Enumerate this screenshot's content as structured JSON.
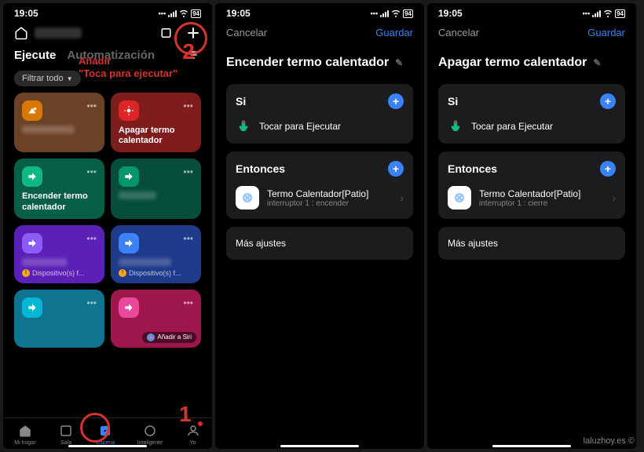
{
  "status": {
    "time": "19:05",
    "battery": "94"
  },
  "screen1": {
    "tabs": {
      "execute": "Ejecute",
      "automation": "Automatización"
    },
    "filter": "Filtrar todo",
    "cards": {
      "c2_title": "Apagar termo calentador",
      "c3_title": "Encender termo calentador",
      "warning": "Dispositivo(s) f...",
      "siri": "Añadir a Siri"
    },
    "nav": {
      "home": "Mi hogar",
      "room": "Sala",
      "scene": "Escena",
      "smart": "Inteligente",
      "me": "Yo"
    },
    "annotations": {
      "add": "Añadir",
      "tap": "\"Toca para ejecutar\"",
      "n1": "1",
      "n2": "2"
    }
  },
  "screen2": {
    "cancel": "Cancelar",
    "save": "Guardar",
    "title": "Encender termo calentador",
    "if": "Si",
    "condition": "Tocar para Ejecutar",
    "then": "Entonces",
    "action_title": "Termo Calentador[Patio]",
    "action_sub": "interruptor 1 : encender",
    "more": "Más ajustes"
  },
  "screen3": {
    "cancel": "Cancelar",
    "save": "Guardar",
    "title": "Apagar termo calentador",
    "if": "Si",
    "condition": "Tocar para Ejecutar",
    "then": "Entonces",
    "action_title": "Termo Calentador[Patio]",
    "action_sub": "interruptor 1 : cierre",
    "more": "Más ajustes"
  },
  "watermark": "laluzhoy.es ©"
}
